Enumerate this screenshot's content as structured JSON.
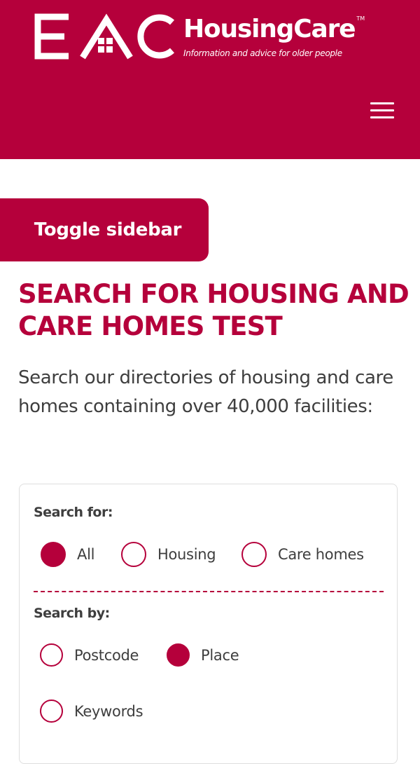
{
  "colors": {
    "brand": "#b5003b",
    "text": "#3e3e3e",
    "panel_border": "#dedede"
  },
  "header": {
    "logo_letters": "EAC",
    "brand_name": "HousingCare",
    "brand_tm": "TM",
    "tagline": "Information and advice for older people",
    "menu_icon": "hamburger-menu-icon"
  },
  "sidebar_toggle": {
    "label": "Toggle sidebar"
  },
  "page": {
    "title": "SEARCH FOR HOUSING AND CARE HOMES TEST",
    "intro": "Search our directories of housing and care homes containing over 40,000 facilities:"
  },
  "search": {
    "search_for": {
      "label": "Search for:",
      "options": [
        {
          "label": "All",
          "checked": true
        },
        {
          "label": "Housing",
          "checked": false
        },
        {
          "label": "Care homes",
          "checked": false
        }
      ]
    },
    "search_by": {
      "label": "Search by:",
      "options": [
        {
          "label": "Postcode",
          "checked": false
        },
        {
          "label": "Place",
          "checked": true
        },
        {
          "label": "Keywords",
          "checked": false
        }
      ]
    }
  }
}
